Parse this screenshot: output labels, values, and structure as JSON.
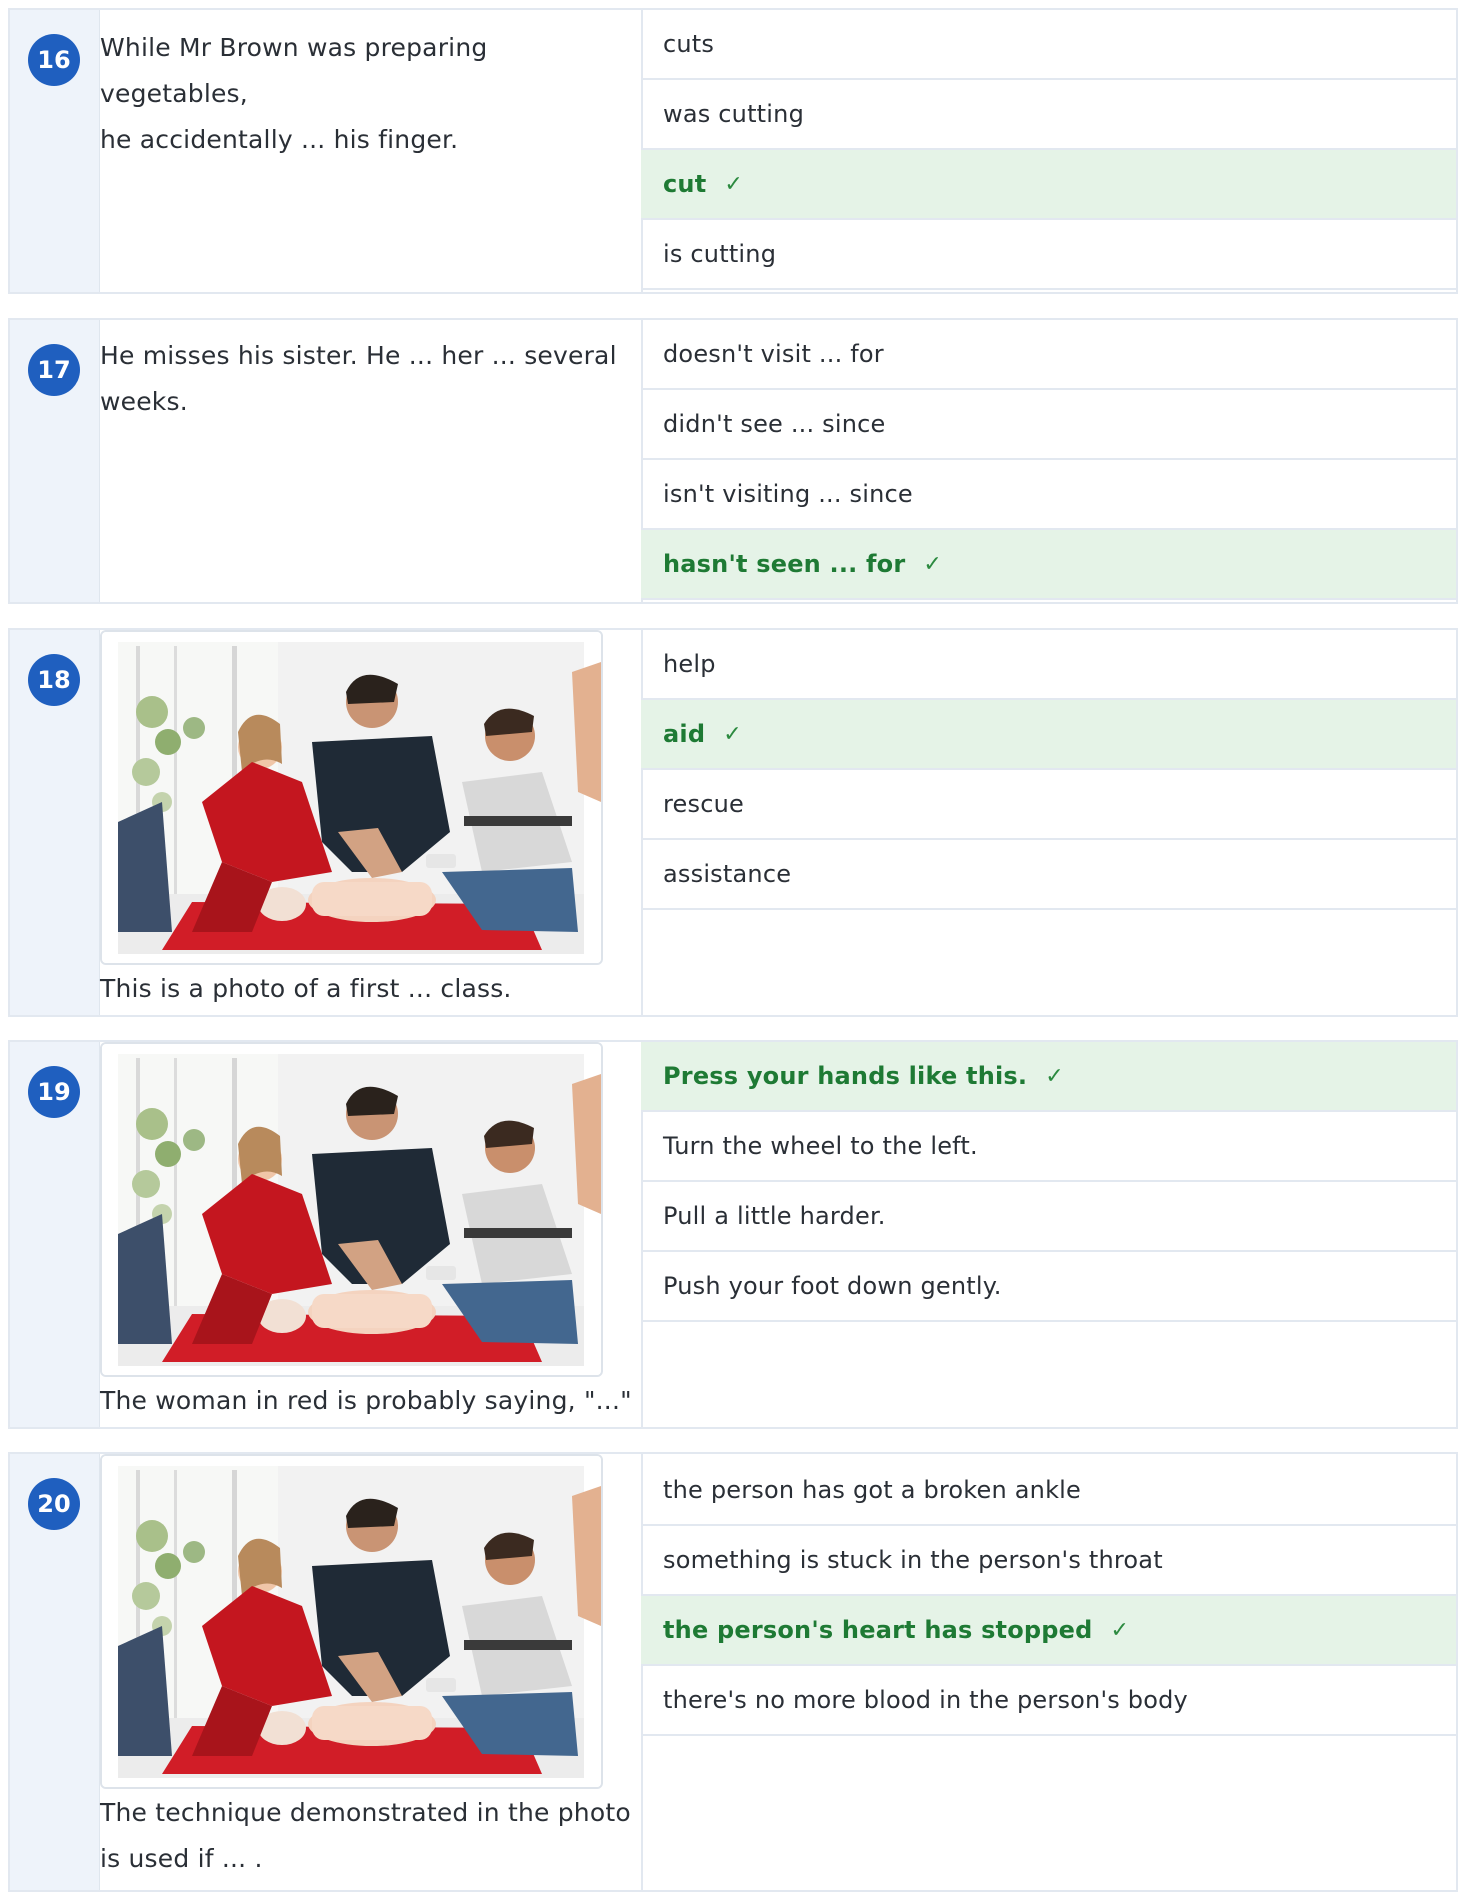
{
  "questions": [
    {
      "number": "16",
      "prompt_lines": [
        "While Mr Brown was preparing vegetables,",
        "he accidentally ... his finger."
      ],
      "has_photo": false,
      "options": [
        {
          "label": "cuts",
          "correct": false
        },
        {
          "label": "was cutting",
          "correct": false
        },
        {
          "label": "cut",
          "correct": true
        },
        {
          "label": "is cutting",
          "correct": false
        }
      ]
    },
    {
      "number": "17",
      "prompt_lines": [
        "He misses his sister. He ... her ... several",
        "weeks."
      ],
      "has_photo": false,
      "options": [
        {
          "label": "doesn't visit ... for",
          "correct": false
        },
        {
          "label": "didn't see ... since",
          "correct": false
        },
        {
          "label": "isn't visiting ... since",
          "correct": false
        },
        {
          "label": "hasn't seen ... for",
          "correct": true
        }
      ]
    },
    {
      "number": "18",
      "prompt_lines": [
        "This is a photo of a first ... class."
      ],
      "has_photo": true,
      "options": [
        {
          "label": "help",
          "correct": false
        },
        {
          "label": "aid",
          "correct": true
        },
        {
          "label": "rescue",
          "correct": false
        },
        {
          "label": "assistance",
          "correct": false
        }
      ]
    },
    {
      "number": "19",
      "prompt_lines": [
        "The woman in red is probably saying, \"...\""
      ],
      "has_photo": true,
      "options": [
        {
          "label": "Press your hands like this.",
          "correct": true
        },
        {
          "label": "Turn the wheel to the left.",
          "correct": false
        },
        {
          "label": "Pull a little harder.",
          "correct": false
        },
        {
          "label": "Push your foot down gently.",
          "correct": false
        }
      ]
    },
    {
      "number": "20",
      "prompt_lines": [
        "The technique demonstrated in the photo",
        "is used if ... ."
      ],
      "has_photo": true,
      "options": [
        {
          "label": "the person has got a broken ankle",
          "correct": false
        },
        {
          "label": "something is stuck in the person's throat",
          "correct": false
        },
        {
          "label": "the person's heart has stopped",
          "correct": true
        },
        {
          "label": "there's no more blood in the person's body",
          "correct": false
        }
      ]
    }
  ],
  "check_mark": "✓",
  "colors": {
    "badge": "#1f5fbf",
    "correct_bg": "#e5f3e7",
    "correct_text": "#1e7a34",
    "number_column_bg": "#eef3fa"
  }
}
